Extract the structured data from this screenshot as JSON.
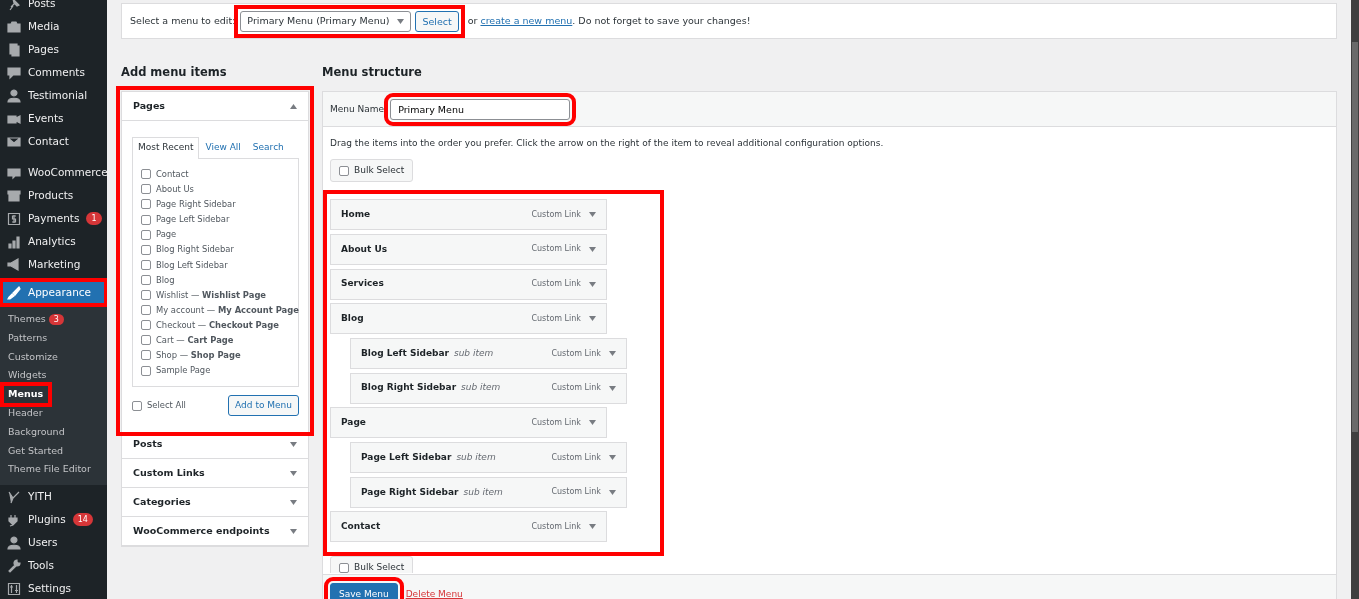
{
  "sidebar": {
    "items": [
      {
        "label": "Posts",
        "selected": false,
        "highlighted": false
      },
      {
        "label": "Media",
        "selected": false,
        "highlighted": false
      },
      {
        "label": "Pages",
        "selected": false,
        "highlighted": false
      },
      {
        "label": "Comments",
        "selected": false,
        "highlighted": false
      },
      {
        "label": "Testimonial",
        "selected": false,
        "highlighted": false
      },
      {
        "label": "Events",
        "selected": false,
        "highlighted": false
      },
      {
        "label": "Contact",
        "selected": false,
        "highlighted": false,
        "gap_after": true
      },
      {
        "label": "WooCommerce",
        "selected": false,
        "highlighted": false
      },
      {
        "label": "Products",
        "selected": false,
        "highlighted": false
      },
      {
        "label": "Payments",
        "selected": false,
        "highlighted": false,
        "badge": "1"
      },
      {
        "label": "Analytics",
        "selected": false,
        "highlighted": false
      },
      {
        "label": "Marketing",
        "selected": false,
        "highlighted": false
      },
      {
        "label": "Appearance",
        "selected": true,
        "highlighted": true,
        "children": [
          {
            "label": "Themes",
            "selected": false,
            "highlighted": false,
            "badge": "3"
          },
          {
            "label": "Patterns",
            "selected": false,
            "highlighted": false
          },
          {
            "label": "Customize",
            "selected": false,
            "highlighted": false
          },
          {
            "label": "Widgets",
            "selected": false,
            "highlighted": false
          },
          {
            "label": "Menus",
            "selected": true,
            "highlighted": true
          },
          {
            "label": "Header",
            "selected": false,
            "highlighted": false
          },
          {
            "label": "Background",
            "selected": false,
            "highlighted": false
          },
          {
            "label": "Get Started",
            "selected": false,
            "highlighted": false
          },
          {
            "label": "Theme File Editor",
            "selected": false,
            "highlighted": false
          }
        ]
      },
      {
        "label": "YITH",
        "selected": false,
        "highlighted": false
      },
      {
        "label": "Plugins",
        "selected": false,
        "highlighted": false,
        "badge": "14"
      },
      {
        "label": "Users",
        "selected": false,
        "highlighted": false
      },
      {
        "label": "Tools",
        "selected": false,
        "highlighted": false
      },
      {
        "label": "Settings",
        "selected": false,
        "highlighted": false
      }
    ]
  },
  "menu_select": {
    "label": "Select a menu to edit:",
    "value": "Primary Menu (Primary Menu)",
    "button": "Select",
    "highlighted": true,
    "text_before": "or",
    "link": "create a new menu",
    "text_after": ". Do not forget to save your changes!"
  },
  "add_items": {
    "title": "Add menu items",
    "sections": [
      {
        "title": "Pages",
        "expanded": true,
        "highlighted": true,
        "tabs": [
          {
            "label": "Most Recent",
            "selected": true
          },
          {
            "label": "View All",
            "selected": false
          },
          {
            "label": "Search",
            "selected": false
          }
        ],
        "items": [
          {
            "label": "Contact",
            "checked": false
          },
          {
            "label": "About Us",
            "checked": false
          },
          {
            "label": "Page Right Sidebar",
            "checked": false
          },
          {
            "label": "Page Left Sidebar",
            "checked": false
          },
          {
            "label": "Page",
            "checked": false
          },
          {
            "label": "Blog Right Sidebar",
            "checked": false
          },
          {
            "label": "Blog Left Sidebar",
            "checked": false
          },
          {
            "label": "Blog",
            "checked": false
          },
          {
            "label": "Wishlist — **Wishlist Page**",
            "checked": false
          },
          {
            "label": "My account — **My Account Page**",
            "checked": false
          },
          {
            "label": "Checkout — **Checkout Page**",
            "checked": false
          },
          {
            "label": "Cart — **Cart Page**",
            "checked": false
          },
          {
            "label": "Shop — **Shop Page**",
            "checked": false
          },
          {
            "label": "Sample Page",
            "checked": false
          }
        ],
        "select_all": {
          "label": "Select All",
          "checked": false
        },
        "button": "Add to Menu"
      },
      {
        "title": "Posts",
        "expanded": false,
        "highlighted": false
      },
      {
        "title": "Custom Links",
        "expanded": false,
        "highlighted": false
      },
      {
        "title": "Categories",
        "expanded": false,
        "highlighted": false
      },
      {
        "title": "WooCommerce endpoints",
        "expanded": false,
        "highlighted": false
      }
    ]
  },
  "menu_structure": {
    "title": "Menu structure",
    "name_label": "Menu Name",
    "name_value": "Primary Menu",
    "name_highlighted": true,
    "instructions": "Drag the items into the order you prefer. Click the arrow on the right of the item to reveal additional configuration options.",
    "bulk_select": [
      {
        "label": "Bulk Select",
        "checked": false
      },
      {
        "label": "Bulk Select",
        "checked": false
      }
    ],
    "items_highlighted": true,
    "items": [
      {
        "title": "Home",
        "type": "Custom Link"
      },
      {
        "title": "About Us",
        "type": "Custom Link"
      },
      {
        "title": "Services",
        "type": "Custom Link"
      },
      {
        "title": "Blog",
        "type": "Custom Link",
        "children": [
          {
            "title": "Blog Left Sidebar",
            "note": "sub item",
            "type": "Custom Link"
          },
          {
            "title": "Blog Right Sidebar",
            "note": "sub item",
            "type": "Custom Link"
          }
        ]
      },
      {
        "title": "Page",
        "type": "Custom Link",
        "children": [
          {
            "title": "Page Left Sidebar",
            "note": "sub item",
            "type": "Custom Link"
          },
          {
            "title": "Page Right Sidebar",
            "note": "sub item",
            "type": "Custom Link"
          }
        ]
      },
      {
        "title": "Contact",
        "type": "Custom Link"
      }
    ],
    "save_button": "Save Menu",
    "save_highlighted": true,
    "delete_link": "Delete Menu"
  }
}
